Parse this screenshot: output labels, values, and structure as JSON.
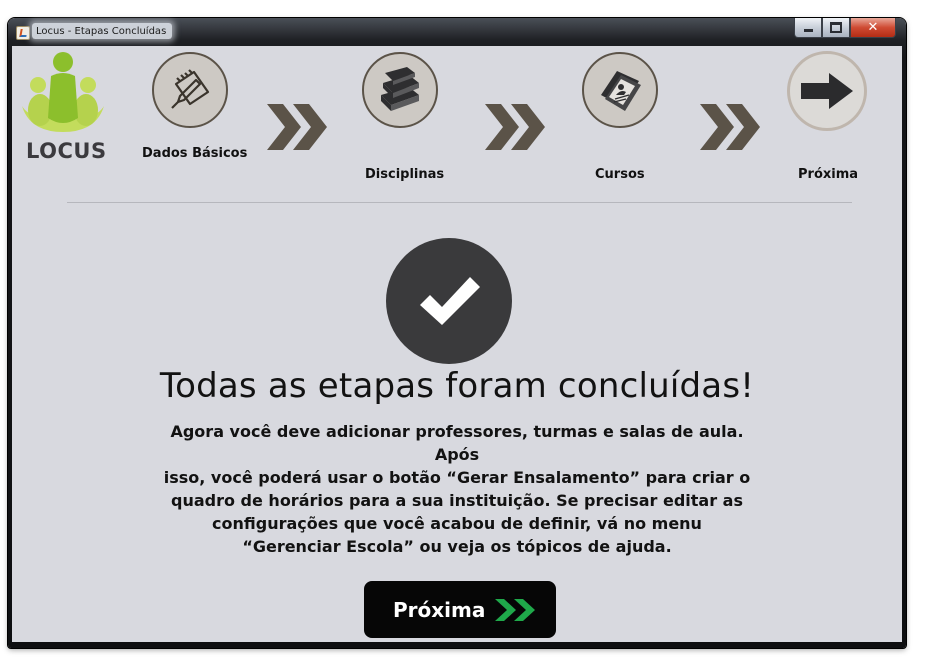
{
  "window": {
    "title": "Locus - Etapas Concluídas"
  },
  "logo": {
    "text": "LOCUS",
    "colors": {
      "green_dark": "#8cbf2c",
      "green_light": "#c3dc5c",
      "text": "#3b3a3e"
    }
  },
  "steps": [
    {
      "label": "Dados Básicos",
      "icon": "notepad-pencil-icon"
    },
    {
      "label": "Disciplinas",
      "icon": "books-icon"
    },
    {
      "label": "Cursos",
      "icon": "documents-icon"
    },
    {
      "label": "Próxima",
      "icon": "arrow-right-icon"
    }
  ],
  "main": {
    "headline": "Todas as etapas foram concluídas!",
    "body_lines": [
      "Agora você deve adicionar professores, turmas e salas de aula. Após",
      "isso, você poderá usar o botão “Gerar Ensalamento” para criar o",
      "quadro de horários para a sua instituição. Se precisar editar as",
      "configurações que você acabou de definir, vá no menu",
      "“Gerenciar Escola” ou veja os tópicos de ajuda."
    ],
    "next_button": {
      "label": "Próxima",
      "icon": "double-chevron-right-icon"
    }
  },
  "colors": {
    "client_bg": "#d8d9df",
    "chevron": "#5b5348",
    "check_circle": "#3a3a3c",
    "button_bg": "#060606",
    "button_chevron": "#1fa84a"
  }
}
